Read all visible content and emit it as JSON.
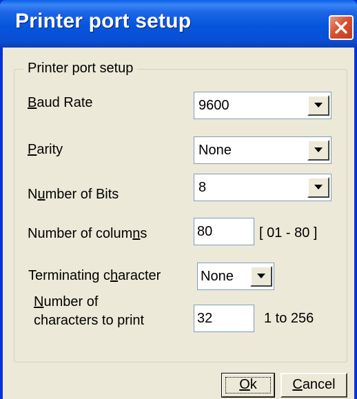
{
  "window": {
    "title": "Printer port setup",
    "close_icon": "close-icon"
  },
  "group": {
    "title": "Printer port setup"
  },
  "fields": {
    "baud_rate": {
      "label_pre": "",
      "label_key": "B",
      "label_post": "aud Rate",
      "value": "9600"
    },
    "parity": {
      "label_pre": "",
      "label_key": "P",
      "label_post": "arity",
      "value": "None"
    },
    "bits": {
      "label_pre": "N",
      "label_key": "u",
      "label_post": "mber of Bits",
      "value": "8"
    },
    "columns": {
      "label_pre": "Number of colum",
      "label_key": "n",
      "label_post": "s",
      "value": "80",
      "range": "[ 01 - 80 ]"
    },
    "terminating": {
      "label_pre": "Terminating c",
      "label_key": "h",
      "label_post": "aracter",
      "value": "None"
    },
    "chars_to_print": {
      "line1_pre": "",
      "line1_key": "N",
      "line1_post": "umber of",
      "line2": "characters to print",
      "value": "32",
      "range": "1 to 256"
    }
  },
  "buttons": {
    "ok": {
      "key": "O",
      "rest": "k"
    },
    "cancel": {
      "key": "C",
      "rest": "ancel"
    }
  },
  "colors": {
    "title_bar": "#0555dc",
    "dialog_bg": "#ece9d8",
    "close_button": "#d8512f"
  }
}
